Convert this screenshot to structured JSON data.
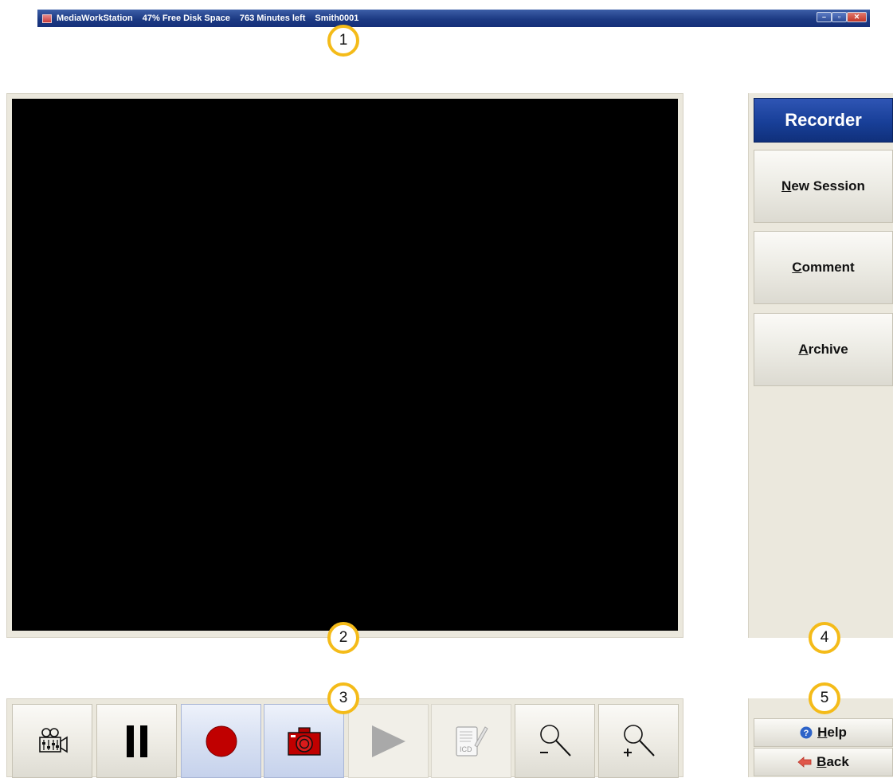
{
  "titlebar": {
    "app_name": "MediaWorkStation",
    "disk_space": "47% Free Disk Space",
    "minutes_left": "763 Minutes left",
    "patient_id": "Smith0001",
    "controls": {
      "minimize": "–",
      "maximize": "▫",
      "close": "✕"
    }
  },
  "callouts": [
    "1",
    "2",
    "3",
    "4",
    "5"
  ],
  "side_panel": {
    "header": "Recorder",
    "buttons": [
      "New Session",
      "Comment",
      "Archive"
    ]
  },
  "toolbar": {
    "buttons": [
      {
        "icon": "camera-settings-icon",
        "state": "normal"
      },
      {
        "icon": "pause-icon",
        "state": "normal"
      },
      {
        "icon": "record-icon",
        "state": "active"
      },
      {
        "icon": "snapshot-camera-icon",
        "state": "active"
      },
      {
        "icon": "play-icon",
        "state": "disabled"
      },
      {
        "icon": "icd-edit-icon",
        "state": "disabled",
        "label": "ICD"
      },
      {
        "icon": "zoom-out-icon",
        "state": "normal"
      },
      {
        "icon": "zoom-in-icon",
        "state": "normal"
      }
    ]
  },
  "side_bottom": {
    "help": "Help",
    "back": "Back"
  },
  "colors": {
    "titlebar": "#1c3a83",
    "header": "#183f98",
    "record_red": "#c00000",
    "callout_ring": "#f4bb19",
    "panel_bg": "#ebe8dd"
  }
}
